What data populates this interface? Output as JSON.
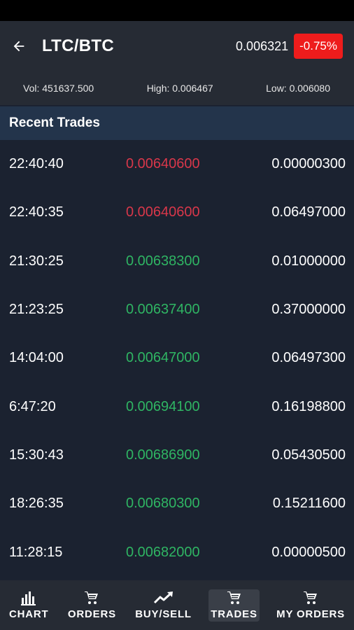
{
  "header": {
    "title": "LTC/BTC",
    "price": "0.006321",
    "change": "-0.75%",
    "back_icon": "arrow-left-icon"
  },
  "stats": {
    "volume": "Vol: 451637.500",
    "high": "High: 0.006467",
    "low": "Low: 0.006080"
  },
  "section": {
    "title": "Recent Trades"
  },
  "trades": [
    {
      "time": "22:40:40",
      "price": "0.00640600",
      "amount": "0.00000300",
      "side": "sell"
    },
    {
      "time": "22:40:35",
      "price": "0.00640600",
      "amount": "0.06497000",
      "side": "sell"
    },
    {
      "time": "21:30:25",
      "price": "0.00638300",
      "amount": "0.01000000",
      "side": "buy"
    },
    {
      "time": "21:23:25",
      "price": "0.00637400",
      "amount": "0.37000000",
      "side": "buy"
    },
    {
      "time": "14:04:00",
      "price": "0.00647000",
      "amount": "0.06497300",
      "side": "buy"
    },
    {
      "time": "6:47:20",
      "price": "0.00694100",
      "amount": "0.16198800",
      "side": "buy"
    },
    {
      "time": "15:30:43",
      "price": "0.00686900",
      "amount": "0.05430500",
      "side": "buy"
    },
    {
      "time": "18:26:35",
      "price": "0.00680300",
      "amount": "0.15211600",
      "side": "buy"
    },
    {
      "time": "11:28:15",
      "price": "0.00682000",
      "amount": "0.00000500",
      "side": "buy"
    }
  ],
  "colors": {
    "sell": "#d8374a",
    "buy": "#2fb563",
    "change_badge": "#ee1c1c",
    "section_head": "#23344b"
  },
  "nav": {
    "items": [
      {
        "label": "CHART",
        "icon": "bar-chart-icon",
        "active": false
      },
      {
        "label": "ORDERS",
        "icon": "cart-icon",
        "active": false
      },
      {
        "label": "BUY/SELL",
        "icon": "trending-up-icon",
        "active": false
      },
      {
        "label": "TRADES",
        "icon": "cart-icon",
        "active": true
      },
      {
        "label": "MY ORDERS",
        "icon": "cart-icon",
        "active": false
      }
    ]
  }
}
